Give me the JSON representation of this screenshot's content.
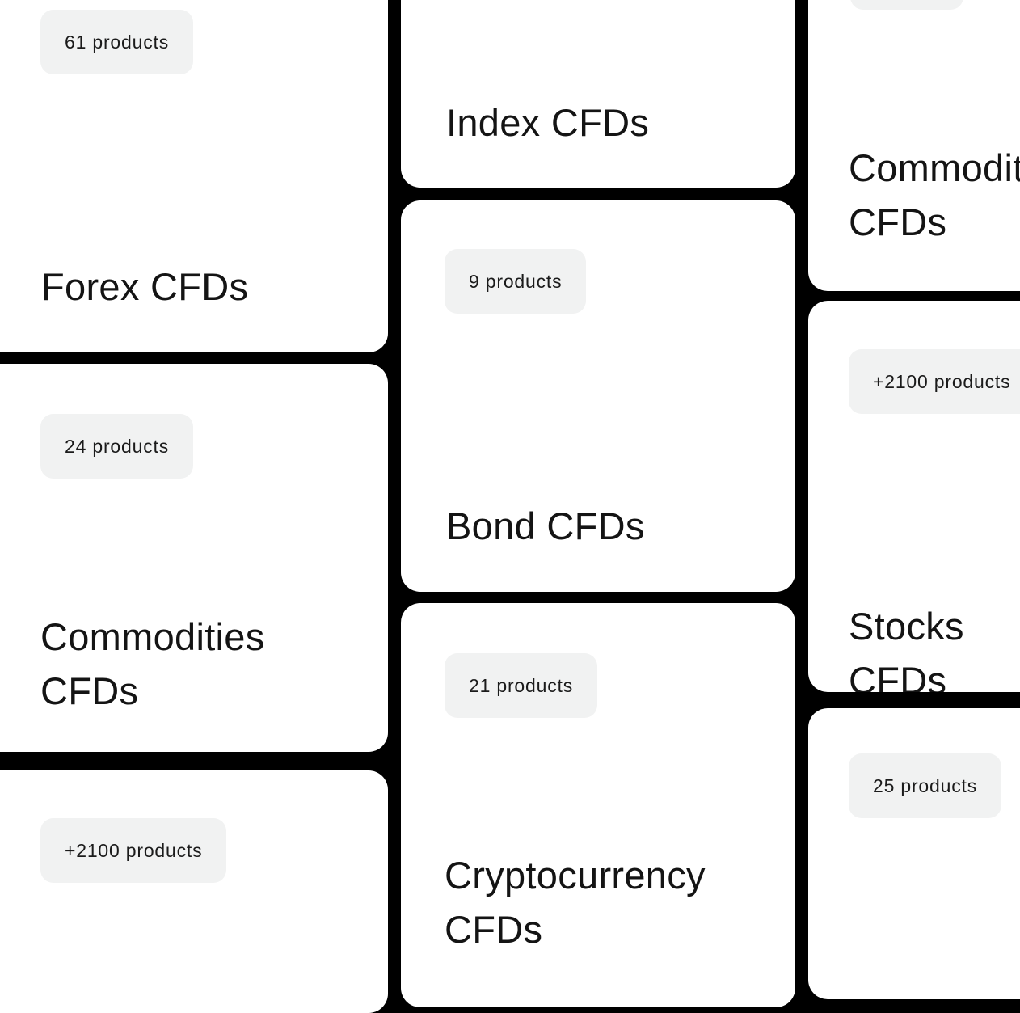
{
  "cards": {
    "forex": {
      "count": "61 products",
      "title": "Forex CFDs"
    },
    "commodities_left": {
      "count": "24 products",
      "title": "Commodities\nCFDs"
    },
    "stocks_left": {
      "count": "+2100 products"
    },
    "index": {
      "title": "Index CFDs"
    },
    "bond": {
      "count": "9 products",
      "title": "Bond CFDs"
    },
    "crypto": {
      "count": "21 products",
      "title": "Cryptocurrency\nCFDs"
    },
    "commodities_right": {
      "title": "Commodities\nCFDs"
    },
    "stocks_right": {
      "count": "+2100 products",
      "title": "Stocks CFDs"
    },
    "right_bottom": {
      "count": "25 products"
    }
  }
}
